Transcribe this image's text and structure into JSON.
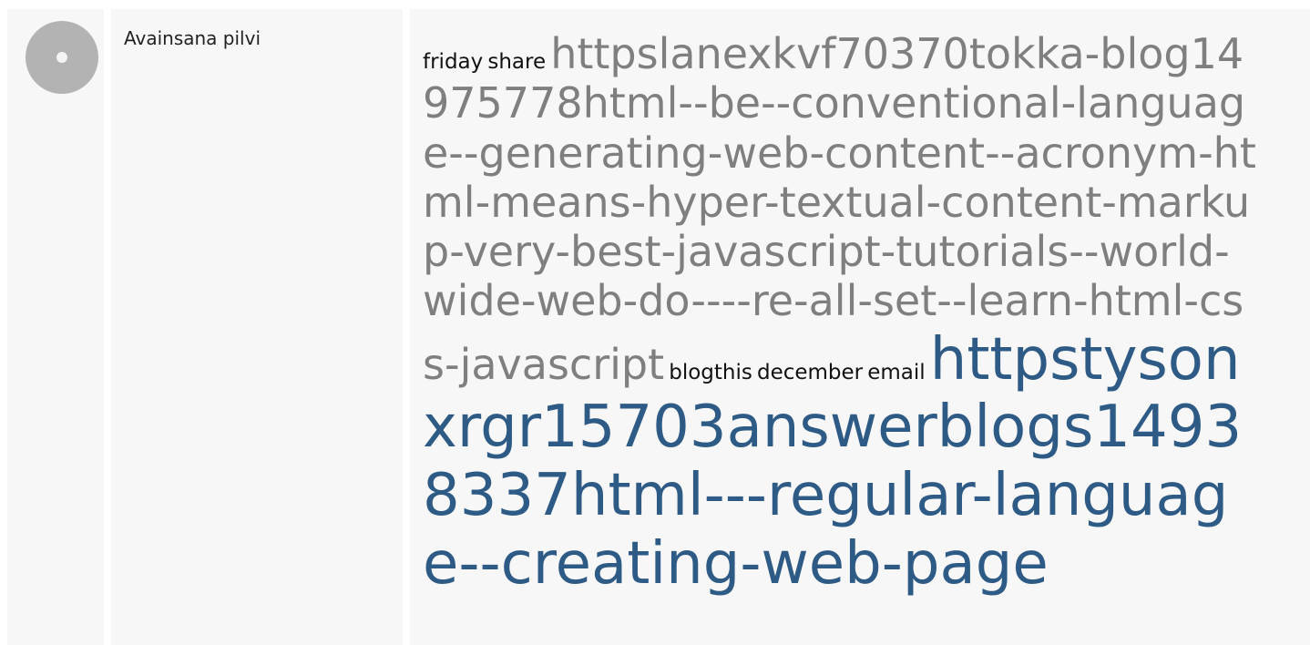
{
  "sidebar": {
    "icon": "cd-disc-icon",
    "label": "Avainsana pilvi"
  },
  "keyword_cloud": {
    "words": [
      {
        "text": "friday",
        "style": "small"
      },
      {
        "text": "share",
        "style": "small"
      },
      {
        "text": "httpslanexkvf70370tokka-blog14975778html--be--conventional-language--generating-web-content--acronym-html-means-hyper-textual-content-markup-very-best-javascript-tutorials--world-wide-web-do----re-all-set--learn-html-css-javascript",
        "style": "grey"
      },
      {
        "text": "blogthis",
        "style": "small"
      },
      {
        "text": "december",
        "style": "small"
      },
      {
        "text": "email",
        "style": "small"
      },
      {
        "text": "httpstysonxrgr15703answerblogs14938337html---regular-language--creating-web-page",
        "style": "blue"
      }
    ],
    "colors": {
      "small": "#111111",
      "grey": "#7f7f7f",
      "blue": "#2e5a86"
    }
  }
}
